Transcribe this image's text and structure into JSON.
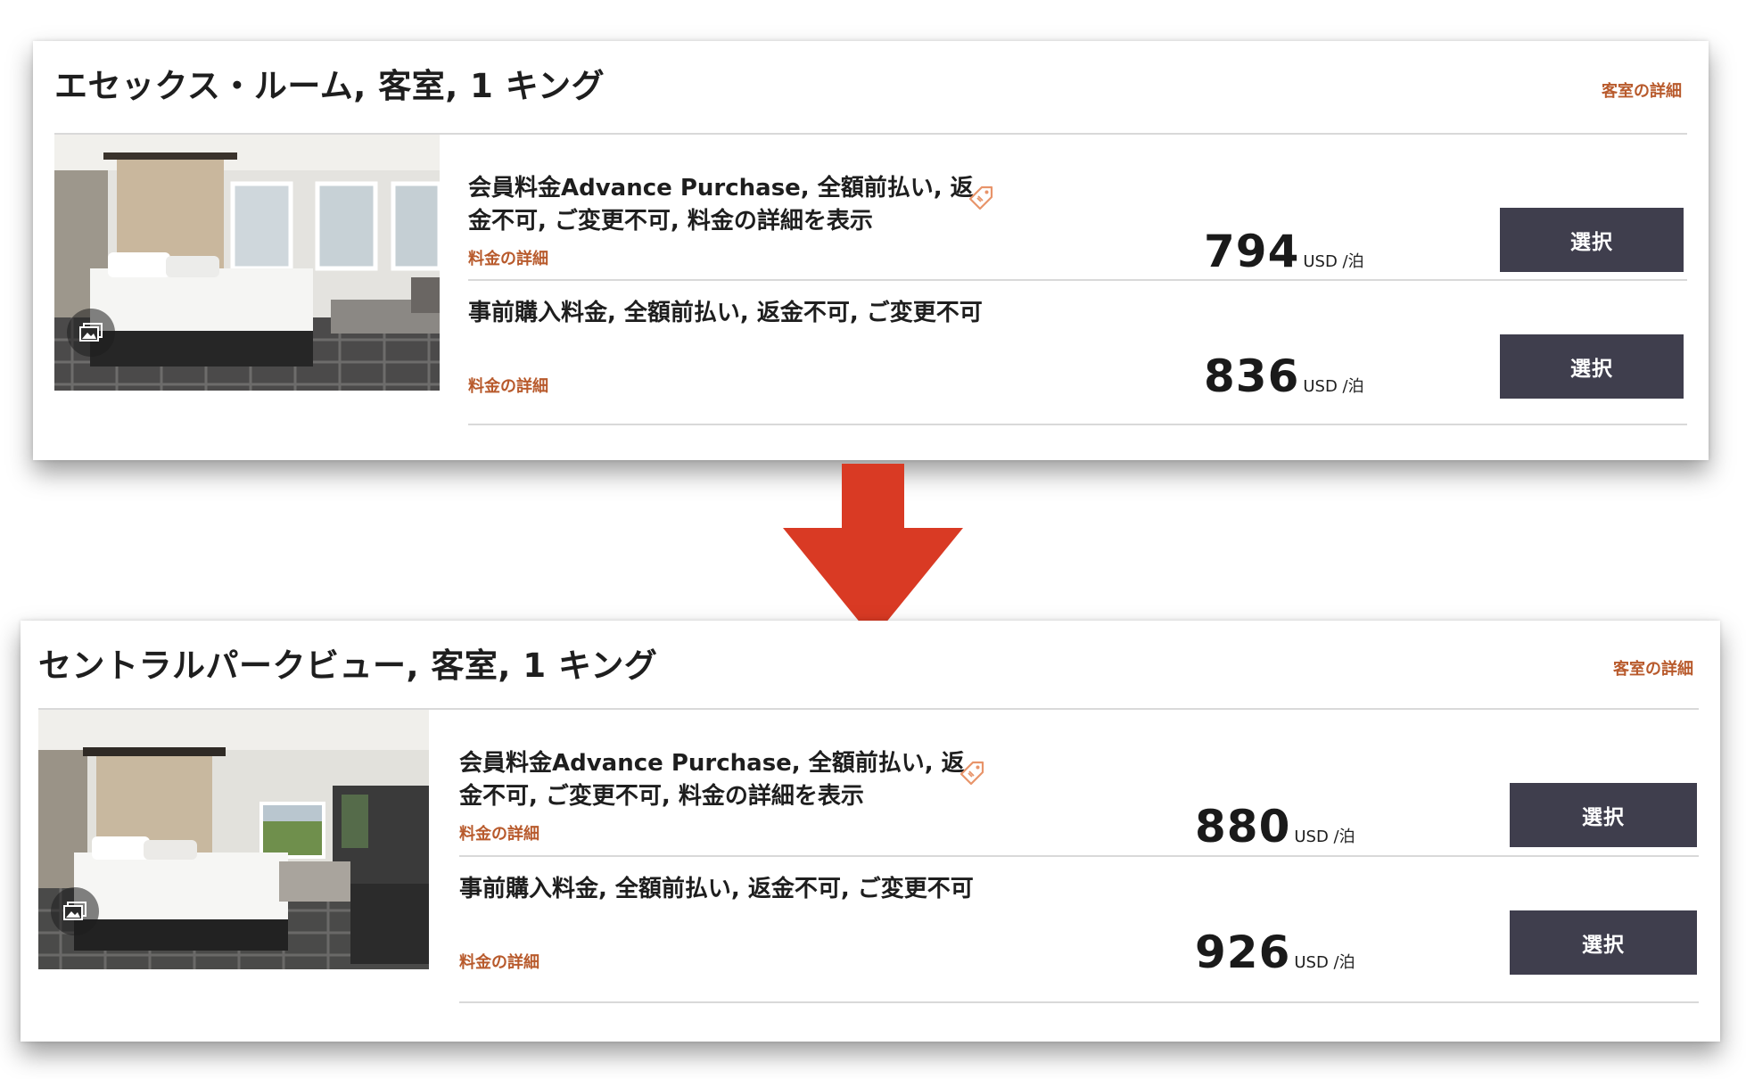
{
  "rooms": [
    {
      "title": "エセックス・ルーム, 客室, 1 キング",
      "details_link": "客室の詳細",
      "rates": [
        {
          "name": "会員料金Advance Purchase, 全額前払い, 返金不可, ご変更不可, 料金の詳細を表示",
          "link": "料金の詳細",
          "price": "794",
          "unit": "USD /泊",
          "button": "選択",
          "has_tag_icon": true
        },
        {
          "name": "事前購入料金, 全額前払い, 返金不可, ご変更不可",
          "link": "料金の詳細",
          "price": "836",
          "unit": "USD /泊",
          "button": "選択",
          "has_tag_icon": false
        }
      ]
    },
    {
      "title": "セントラルパークビュー, 客室, 1 キング",
      "details_link": "客室の詳細",
      "rates": [
        {
          "name": "会員料金Advance Purchase, 全額前払い, 返金不可, ご変更不可, 料金の詳細を表示",
          "link": "料金の詳細",
          "price": "880",
          "unit": "USD /泊",
          "button": "選択",
          "has_tag_icon": true
        },
        {
          "name": "事前購入料金, 全額前払い, 返金不可, ご変更不可",
          "link": "料金の詳細",
          "price": "926",
          "unit": "USD /泊",
          "button": "選択",
          "has_tag_icon": false
        }
      ]
    }
  ],
  "icons": {
    "gallery": "gallery-icon",
    "tag": "price-tag-icon",
    "arrow": "down-arrow-icon"
  },
  "colors": {
    "accent_link": "#b85a2c",
    "button_bg": "#3f3e4d",
    "arrow": "#d93a24",
    "tag": "#e8946a"
  }
}
